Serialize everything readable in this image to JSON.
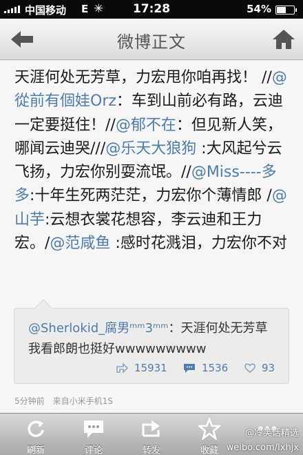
{
  "status_bar": {
    "carrier": "中国移动",
    "network": "E",
    "time": "17:28",
    "battery_text": "54%",
    "battery_level": 0.54
  },
  "nav": {
    "title": "微博正文",
    "back_icon": "back-arrow-icon",
    "home_icon": "home-icon"
  },
  "post": {
    "segments": [
      {
        "text": "天涯何处无芳草，力宏甩你咱再找！ //",
        "mention": false
      },
      {
        "text": "@從前有個娃Orz",
        "mention": true
      },
      {
        "text": "：车到山前必有路，云迪一定要挺住！//",
        "mention": false
      },
      {
        "text": "@郁不在",
        "mention": true
      },
      {
        "text": "：但见新人笑，哪闻云迪哭///",
        "mention": false
      },
      {
        "text": "@乐天大狼狗",
        "mention": true
      },
      {
        "text": " :大风起兮云飞扬，力宏你别耍流氓。//",
        "mention": false
      },
      {
        "text": "@Miss----多多",
        "mention": true
      },
      {
        "text": ":十年生死两茫茫，力宏你个薄情郎 /",
        "mention": false
      },
      {
        "text": "@山芋",
        "mention": true
      },
      {
        "text": ":云想衣裳花想容，李云迪和王力宏。/",
        "mention": false
      },
      {
        "text": "@范咸鱼",
        "mention": true
      },
      {
        "text": " :感时花溅泪，力宏你不对",
        "mention": false
      }
    ]
  },
  "repost": {
    "author": "@Sherlokid_腐男ᵐᵐ3ᵐᵐ",
    "text": "：天涯何处无芳草 我看郎朗也挺好wwwwwwwww",
    "reposts": "15931",
    "comments": "1536",
    "likes": "93"
  },
  "meta": {
    "time_ago": "5分钟前",
    "source": "来自小米手机1S"
  },
  "toolbar": {
    "items": [
      {
        "label": "刷新",
        "icon": "refresh-icon"
      },
      {
        "label": "评论",
        "icon": "comment-icon"
      },
      {
        "label": "转发",
        "icon": "repost-icon"
      },
      {
        "label": "收藏",
        "icon": "star-icon"
      },
      {
        "label": "",
        "icon": "more-icon"
      }
    ]
  },
  "watermark": {
    "line1": "@冷笑话精选",
    "line2": "weibo.com/lxhjx"
  },
  "colors": {
    "mention": "#4e7cab",
    "background": "#f6f6f6"
  }
}
